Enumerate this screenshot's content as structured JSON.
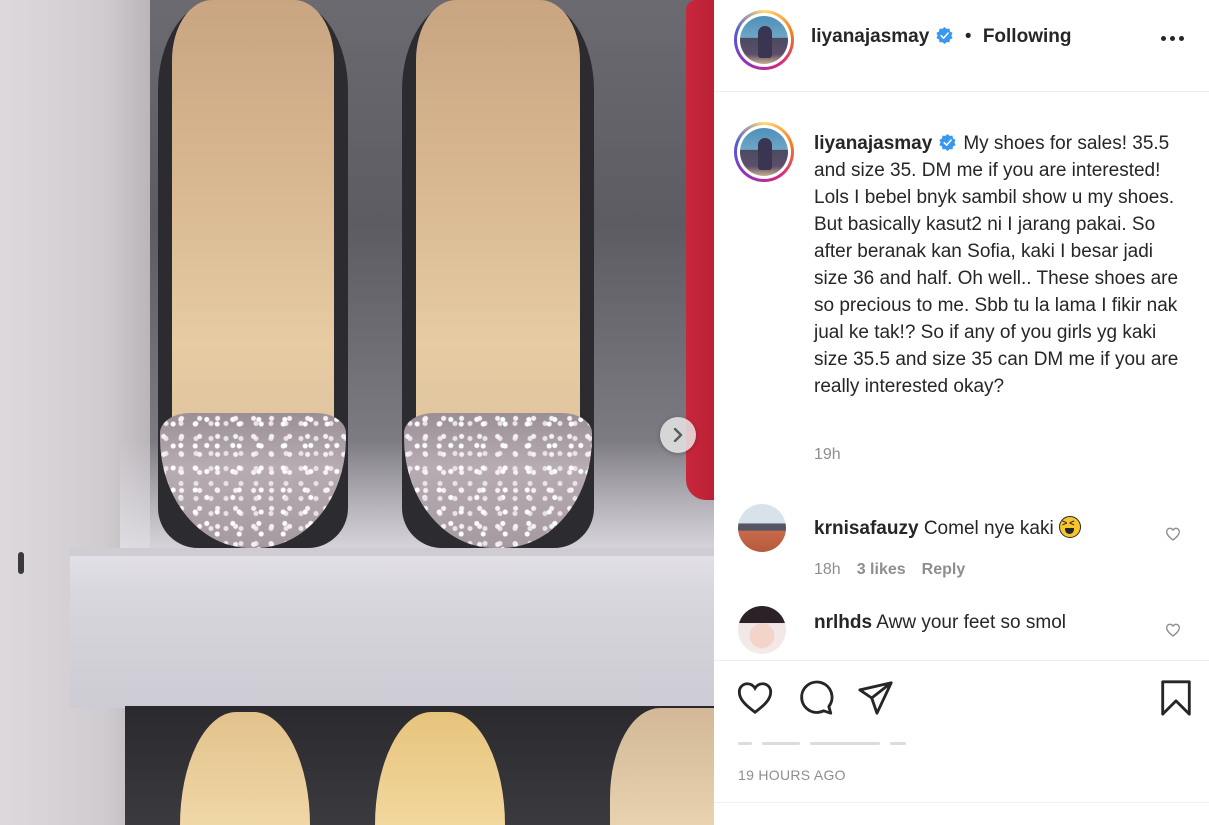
{
  "post": {
    "username": "liyanajasmay",
    "follow_status": "Following",
    "separator": "•",
    "caption": "My shoes for sales! 35.5 and size 35. DM me if you are interested! Lols I bebel bnyk sambil show u my shoes. But basically kasut2 ni I jarang pakai. So after beranak kan Sofia, kaki I besar jadi size 36 and half. Oh well.. These shoes are so precious to me. Sbb tu la lama I fikir nak jual ke tak!? So if any of you girls yg kaki size 35.5 and size 35 can DM me if you are really interested okay?",
    "caption_time": "19h",
    "time_ago": "19 HOURS AGO"
  },
  "comments": [
    {
      "username": "krnisafauzy",
      "text": "Comel nye kaki",
      "emoji": "laughing-squint-emoji",
      "time": "18h",
      "likes": "3 likes",
      "reply": "Reply"
    },
    {
      "username": "nrlhds",
      "text": "Aww your feet so smol"
    }
  ],
  "icons": {
    "verified": "verified-badge-icon",
    "more": "more-options-icon",
    "next": "chevron-right-icon",
    "like": "heart-icon",
    "comment": "comment-bubble-icon",
    "share": "paper-plane-icon",
    "save": "bookmark-icon",
    "comment_like": "small-heart-icon"
  },
  "colors": {
    "verified_blue": "#3897f0",
    "text_primary": "#262626",
    "text_secondary": "#8e8e8e",
    "divider": "#efefef"
  }
}
